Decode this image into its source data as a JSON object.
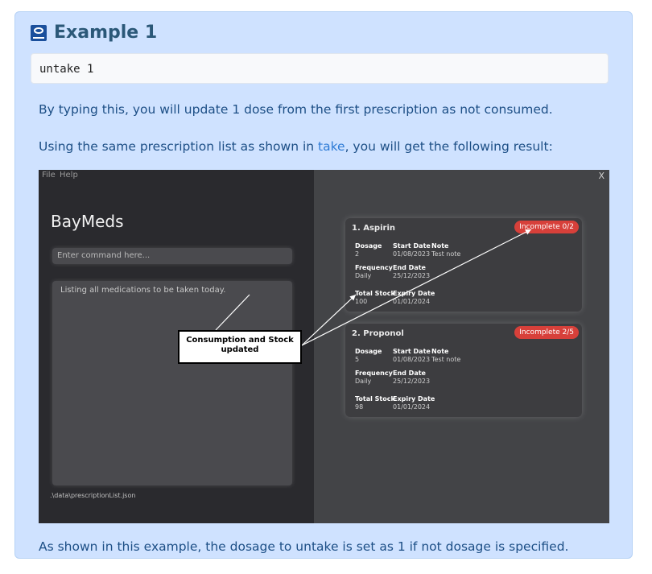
{
  "heading": "Example 1",
  "code": "untake 1",
  "para1": "By typing this, you will update 1 dose from the first prescription as not consumed.",
  "para2_prefix": "Using the same prescription list as shown in ",
  "para2_link": "take",
  "para2_suffix": ", you will get the following result:",
  "para3": "As shown in this example, the dosage to untake is set as 1 if not dosage is specified.",
  "app": {
    "menu_file": "File",
    "menu_help": "Help",
    "close": "X",
    "title": "BayMeds",
    "command_placeholder": "Enter command here...",
    "result_text": "Listing all medications to be taken today.",
    "footer_path": ".\\data\\prescriptionList.json",
    "callout": "Consumption and Stock updated",
    "cards": [
      {
        "title": "1.  Aspirin",
        "badge": "Incomplete 0/2",
        "dosage_label": "Dosage",
        "dosage": "2",
        "start_label": "Start Date",
        "start": "01/08/2023",
        "note_label": "Note",
        "note": "Test note",
        "freq_label": "Frequency",
        "freq": "Daily",
        "end_label": "End Date",
        "end": "25/12/2023",
        "stock_label": "Total Stock",
        "stock": "100",
        "expiry_label": "Expiry Date",
        "expiry": "01/01/2024"
      },
      {
        "title": "2.  Proponol",
        "badge": "Incomplete 2/5",
        "dosage_label": "Dosage",
        "dosage": "5",
        "start_label": "Start Date",
        "start": "01/08/2023",
        "note_label": "Note",
        "note": "Test note",
        "freq_label": "Frequency",
        "freq": "Daily",
        "end_label": "End Date",
        "end": "25/12/2023",
        "stock_label": "Total Stock",
        "stock": "98",
        "expiry_label": "Expiry Date",
        "expiry": "01/01/2024"
      }
    ]
  },
  "colors": {
    "panel": "#cfe2ff",
    "text": "#1d4f86",
    "link": "#2e7bd6",
    "badge": "#d7403a"
  }
}
